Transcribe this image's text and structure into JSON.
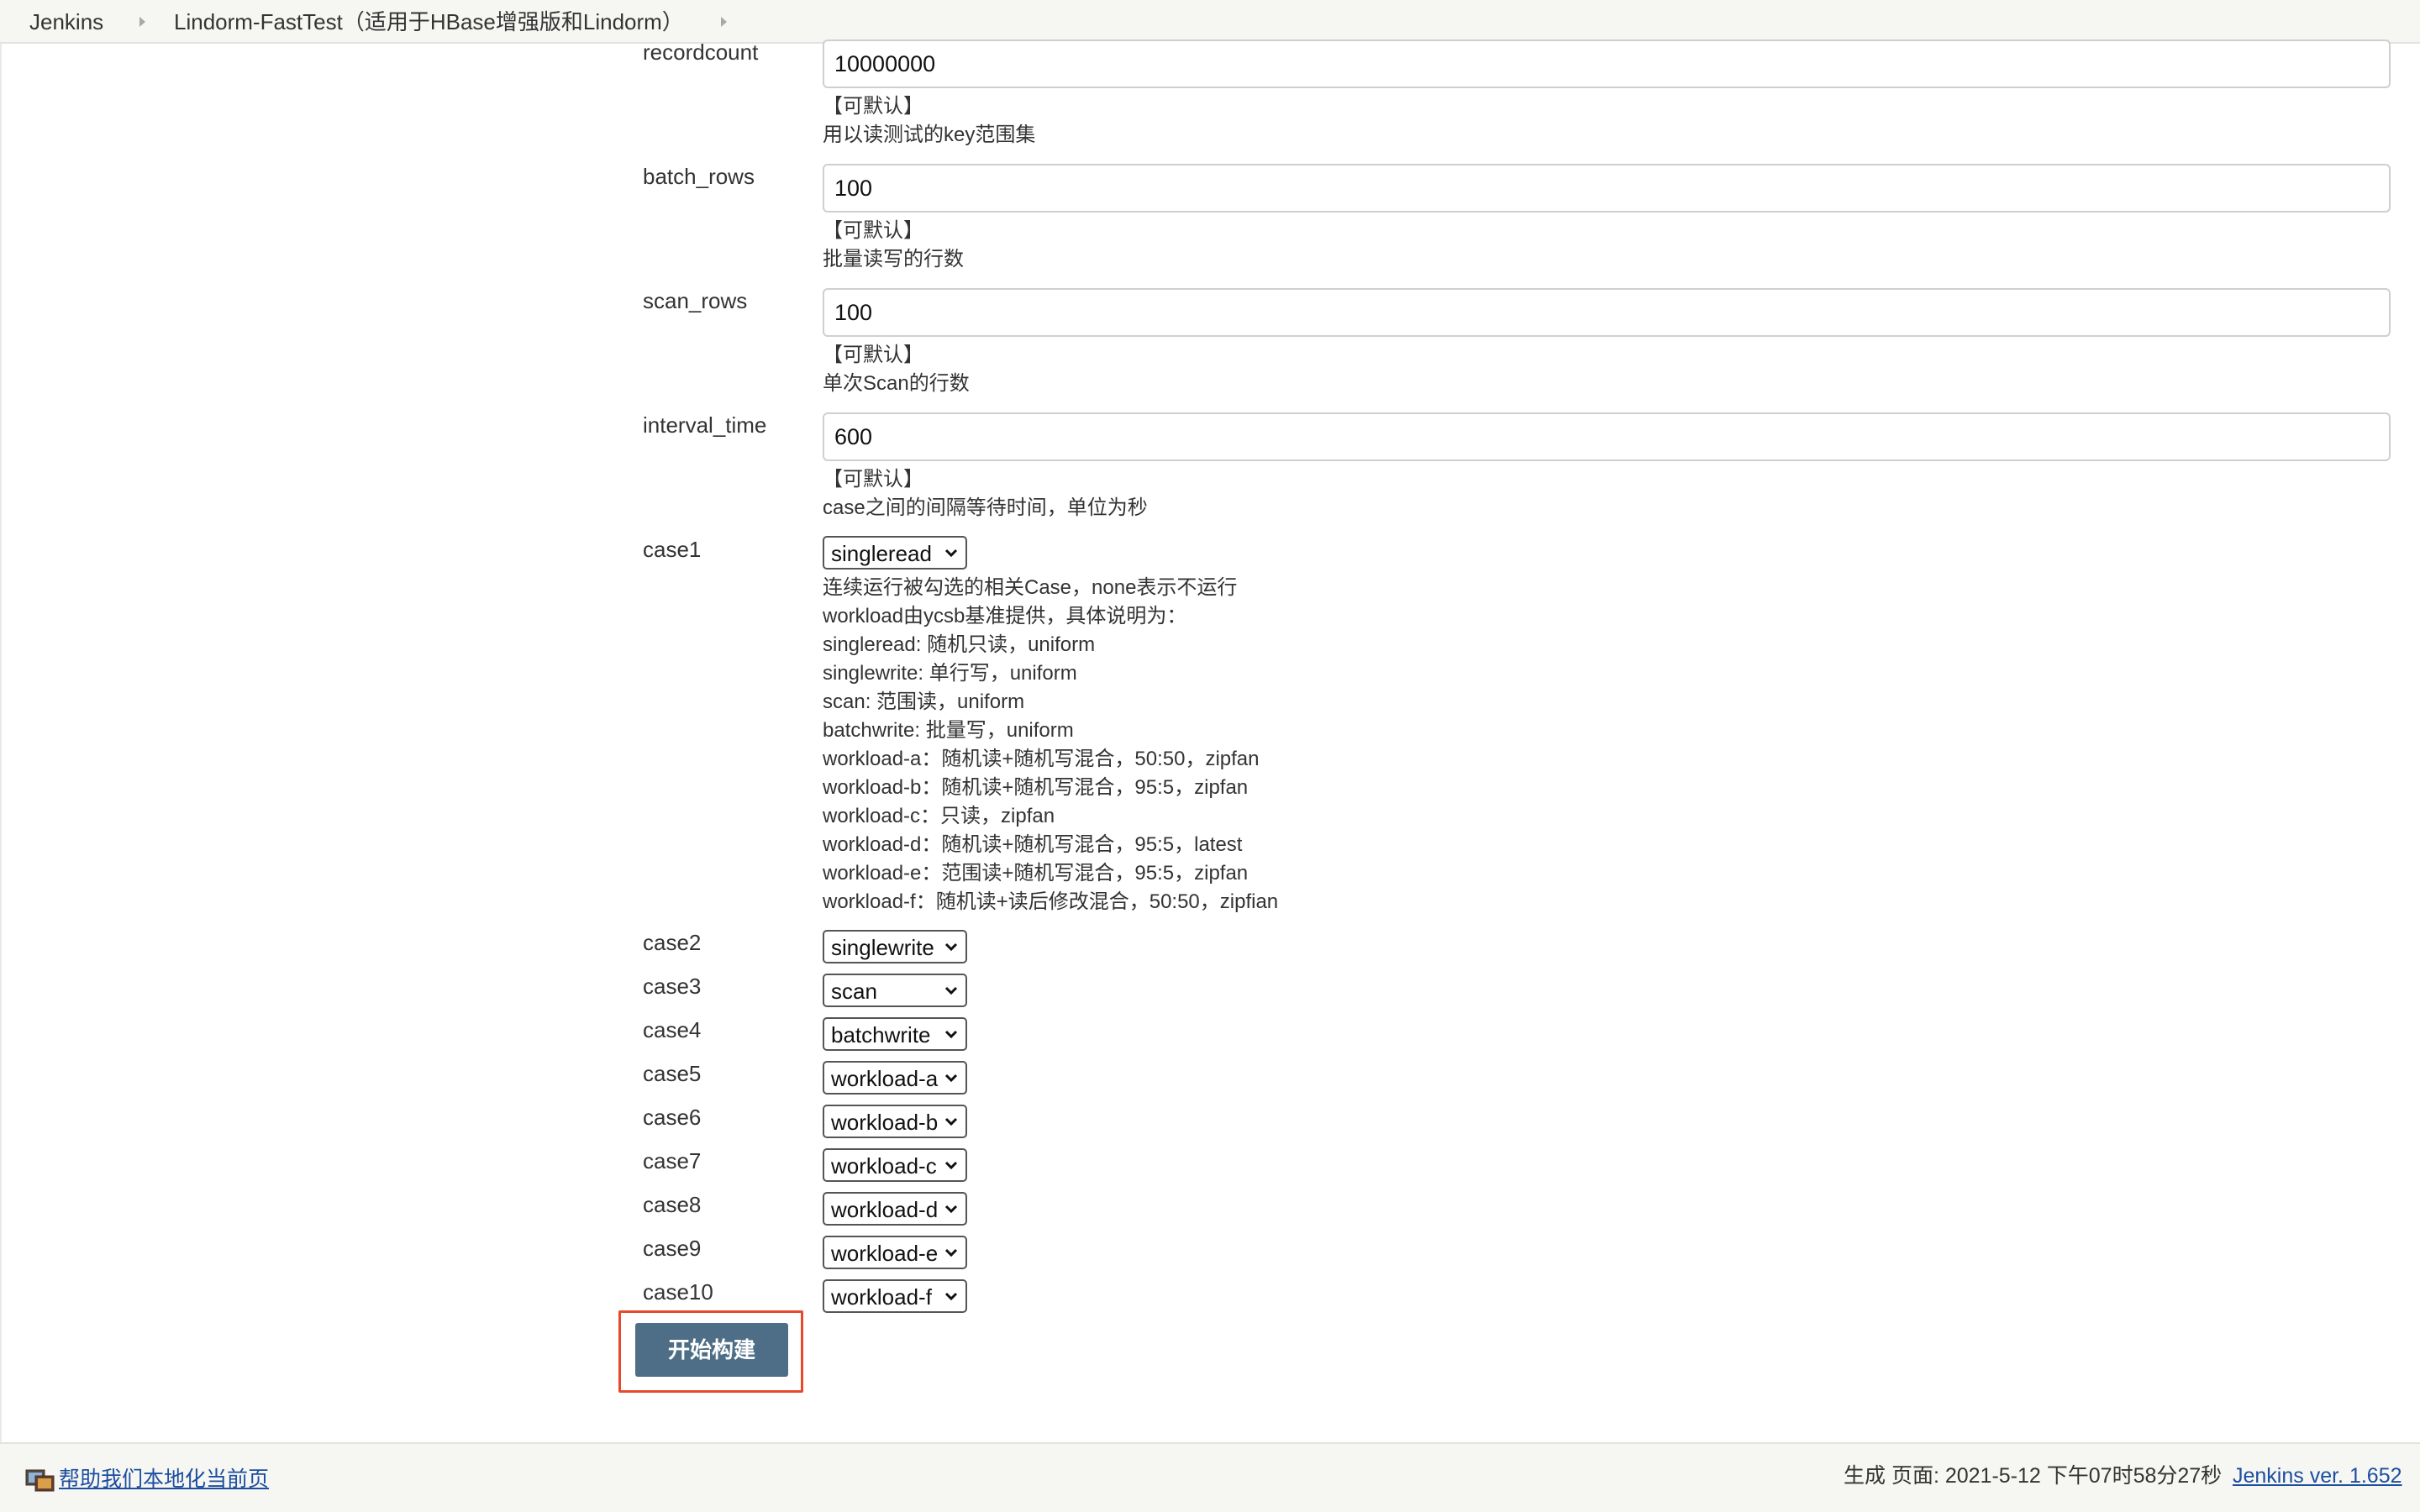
{
  "breadcrumb": {
    "items": [
      {
        "label": "Jenkins"
      },
      {
        "label": "Lindorm-FastTest（适用于HBase增强版和Lindorm）"
      }
    ]
  },
  "params": [
    {
      "name": "recordcount",
      "value": "10000000",
      "help": [
        "【可默认】",
        "用以读测试的key范围集"
      ]
    },
    {
      "name": "batch_rows",
      "value": "100",
      "help": [
        "【可默认】",
        "批量读写的行数"
      ]
    },
    {
      "name": "scan_rows",
      "value": "100",
      "help": [
        "【可默认】",
        "单次Scan的行数"
      ]
    },
    {
      "name": "interval_time",
      "value": "600",
      "help": [
        "【可默认】",
        "case之间的间隔等待时间，单位为秒"
      ]
    }
  ],
  "cases": [
    {
      "name": "case1",
      "selected": "singleread"
    },
    {
      "name": "case2",
      "selected": "singlewrite"
    },
    {
      "name": "case3",
      "selected": "scan"
    },
    {
      "name": "case4",
      "selected": "batchwrite"
    },
    {
      "name": "case5",
      "selected": "workload-a"
    },
    {
      "name": "case6",
      "selected": "workload-b"
    },
    {
      "name": "case7",
      "selected": "workload-c"
    },
    {
      "name": "case8",
      "selected": "workload-d"
    },
    {
      "name": "case9",
      "selected": "workload-e"
    },
    {
      "name": "case10",
      "selected": "workload-f"
    }
  ],
  "case_help": [
    "连续运行被勾选的相关Case，none表示不运行",
    "workload由ycsb基准提供，具体说明为：",
    "singleread: 随机只读，uniform",
    "singlewrite: 单行写，uniform",
    "scan: 范围读，uniform",
    "batchwrite: 批量写，uniform",
    "workload-a：随机读+随机写混合，50:50，zipfan",
    "workload-b：随机读+随机写混合，95:5，zipfan",
    "workload-c：只读，zipfan",
    "workload-d：随机读+随机写混合，95:5，latest",
    "workload-e：范围读+随机写混合，95:5，zipfan",
    "workload-f：随机读+读后修改混合，50:50，zipfian"
  ],
  "submit": {
    "label": "开始构建"
  },
  "footer": {
    "localize_link": "帮助我们本地化当前页",
    "generated": "生成 页面: 2021-5-12 下午07时58分27秒",
    "version_link": "Jenkins ver. 1.652"
  },
  "colors": {
    "submit_bg": "#4d6e86",
    "highlight_border": "#e64a2a",
    "link": "#1d4ea0",
    "bar_bg": "#f6f7f3"
  }
}
